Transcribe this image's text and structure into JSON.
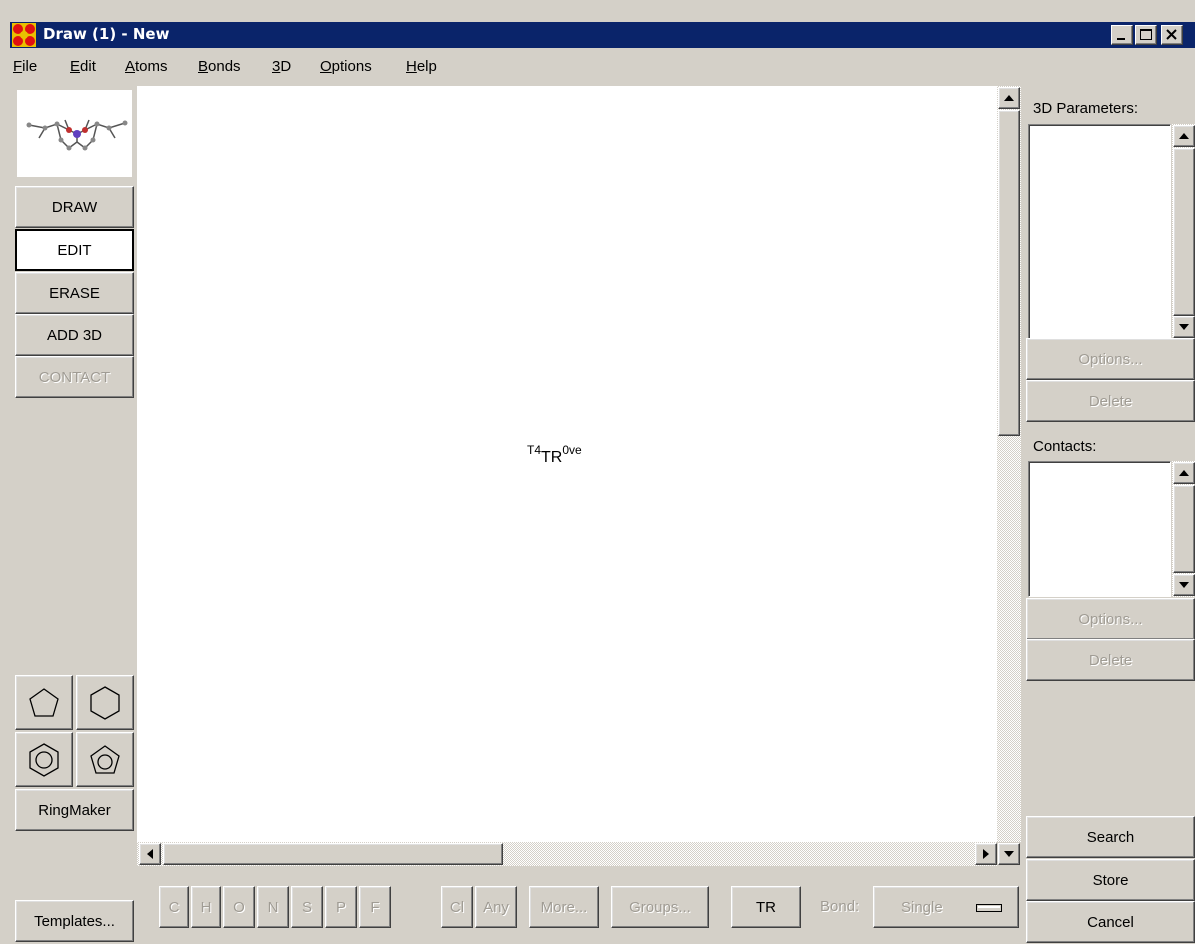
{
  "window": {
    "title": "Draw (1) - New"
  },
  "menu": [
    "File",
    "Edit",
    "Atoms",
    "Bonds",
    "3D",
    "Options",
    "Help"
  ],
  "menu_mnemonics": [
    "F",
    "E",
    "A",
    "B",
    "3",
    "O",
    "H"
  ],
  "left_tools": {
    "draw": "DRAW",
    "edit": "EDIT",
    "erase": "ERASE",
    "add3d": "ADD 3D",
    "contact": "CONTACT",
    "ringmaker": "RingMaker",
    "templates": "Templates..."
  },
  "canvas": {
    "molecule": {
      "prefix": "T4",
      "main": "TR",
      "suffix": "0ve"
    }
  },
  "atom_bar": {
    "atoms": [
      "C",
      "H",
      "O",
      "N",
      "S",
      "P",
      "F",
      "Cl",
      "Any"
    ],
    "more": "More...",
    "groups": "Groups...",
    "current": "TR",
    "bond_label": "Bond:",
    "bond_value": "Single"
  },
  "right_panel": {
    "params_label": "3D Parameters:",
    "params_options": "Options...",
    "params_delete": "Delete",
    "contacts_label": "Contacts:",
    "contacts_options": "Options...",
    "contacts_delete": "Delete",
    "search": "Search",
    "store": "Store",
    "cancel": "Cancel"
  },
  "colors": {
    "titlebar": "#0a246a",
    "face": "#d4d0c8",
    "disabled_text": "#a09c94"
  }
}
